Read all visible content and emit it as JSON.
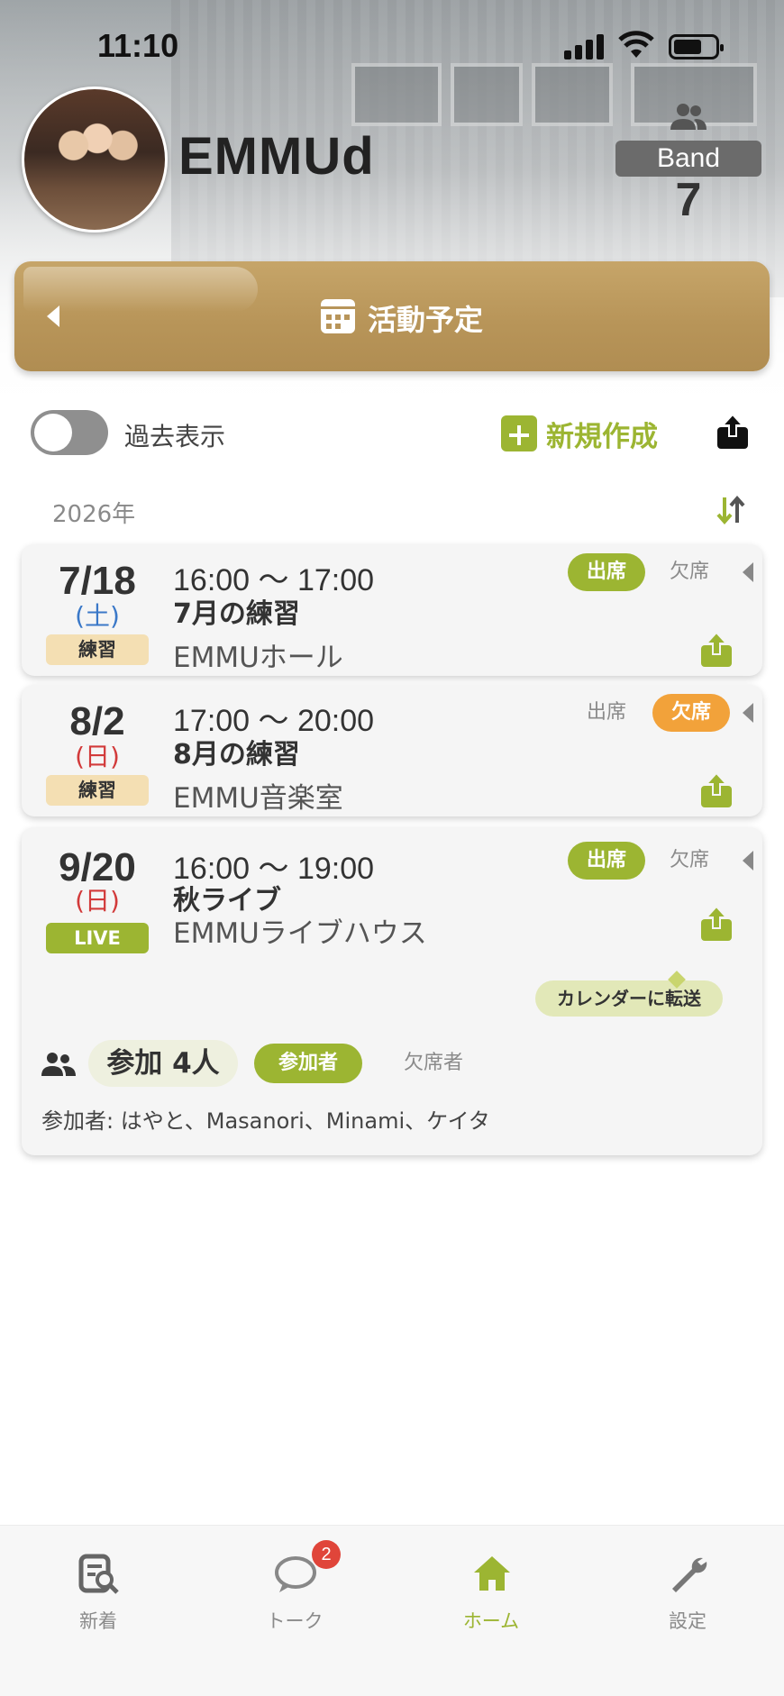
{
  "status": {
    "time": "11:10"
  },
  "header": {
    "band_name": "EMMUd",
    "band_label": "Band",
    "member_count": "7",
    "page_title": "活動予定"
  },
  "toolbar": {
    "toggle_label": "過去表示",
    "new_label": "新規作成"
  },
  "year_label": "2026年",
  "events": [
    {
      "date": "7/18",
      "dow": "(土)",
      "category": "練習",
      "time": "16:00 〜 17:00",
      "title": "7月の練習",
      "place": "EMMUホール",
      "attend": "出席",
      "absent": "欠席"
    },
    {
      "date": "8/2",
      "dow": "(日)",
      "category": "練習",
      "time": "17:00 〜 20:00",
      "title": "8月の練習",
      "place": "EMMU音楽室",
      "attend": "出席",
      "absent": "欠席"
    },
    {
      "date": "9/20",
      "dow": "(日)",
      "category": "LIVE",
      "time": "16:00 〜 19:00",
      "title": "秋ライブ",
      "place": "EMMUライブハウス",
      "attend": "出席",
      "absent": "欠席",
      "calendar_tip": "カレンダーに転送",
      "count": "参加 4人",
      "tab_participants": "参加者",
      "tab_absentees": "欠席者",
      "participants": "参加者: はやと、Masanori、Minami、ケイタ"
    }
  ],
  "nav": {
    "items": [
      {
        "label": "新着"
      },
      {
        "label": "トーク",
        "badge": "2"
      },
      {
        "label": "ホーム"
      },
      {
        "label": "設定"
      }
    ]
  },
  "colors": {
    "accent": "#9cb532",
    "title_bar": "#b8955a",
    "absent_active": "#f2a23a"
  }
}
